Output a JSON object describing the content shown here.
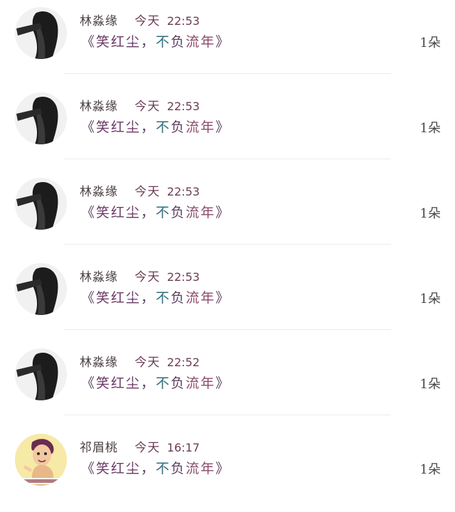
{
  "messages": [
    {
      "user": "林淼缘",
      "day": "今天",
      "time": "22:53",
      "text_open": "《",
      "text_a": "笑红尘",
      "text_comma": "，",
      "text_b": "不",
      "text_c": "负",
      "text_d": "流年",
      "text_close": "》",
      "count": "1朵",
      "avatar": "portrait"
    },
    {
      "user": "林淼缘",
      "day": "今天",
      "time": "22:53",
      "text_open": "《",
      "text_a": "笑红尘",
      "text_comma": "，",
      "text_b": "不",
      "text_c": "负",
      "text_d": "流年",
      "text_close": "》",
      "count": "1朵",
      "avatar": "portrait"
    },
    {
      "user": "林淼缘",
      "day": "今天",
      "time": "22:53",
      "text_open": "《",
      "text_a": "笑红尘",
      "text_comma": "，",
      "text_b": "不",
      "text_c": "负",
      "text_d": "流年",
      "text_close": "》",
      "count": "1朵",
      "avatar": "portrait"
    },
    {
      "user": "林淼缘",
      "day": "今天",
      "time": "22:53",
      "text_open": "《",
      "text_a": "笑红尘",
      "text_comma": "，",
      "text_b": "不",
      "text_c": "负",
      "text_d": "流年",
      "text_close": "》",
      "count": "1朵",
      "avatar": "portrait"
    },
    {
      "user": "林淼缘",
      "day": "今天",
      "time": "22:52",
      "text_open": "《",
      "text_a": "笑红尘",
      "text_comma": "，",
      "text_b": "不",
      "text_c": "负",
      "text_d": "流年",
      "text_close": "》",
      "count": "1朵",
      "avatar": "portrait"
    },
    {
      "user": "祁眉桃",
      "day": "今天",
      "time": "16:17",
      "text_open": "《",
      "text_a": "笑红尘",
      "text_comma": "，",
      "text_b": "不",
      "text_c": "负",
      "text_d": "流年",
      "text_close": "》",
      "count": "1朵",
      "avatar": "cartoon"
    }
  ]
}
